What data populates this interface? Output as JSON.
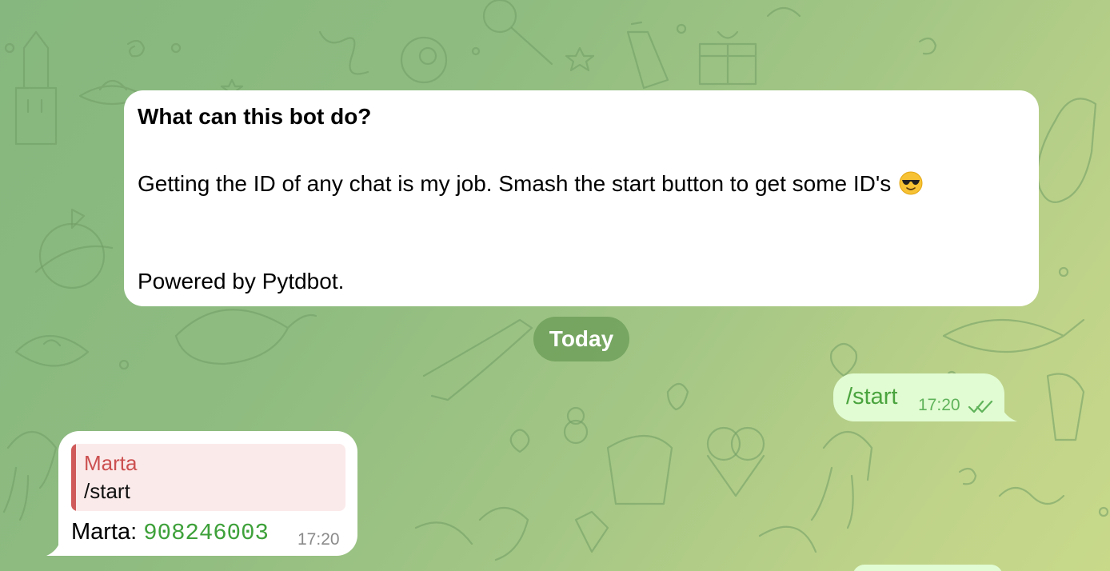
{
  "bot_info": {
    "title": "What can this bot do?",
    "description": "Getting the ID of any chat is my job. Smash the start button to get some ID's",
    "emoji_icon": "smiling-face-with-sunglasses-icon",
    "powered_by": "Powered by Pytdbot."
  },
  "date_separator": "Today",
  "outgoing_message": {
    "text": "/start",
    "time": "17:20",
    "status_icon": "double-check-icon"
  },
  "incoming_message": {
    "reply": {
      "name": "Marta",
      "text": "/start"
    },
    "sender": "Marta",
    "separator": ": ",
    "chat_id": "908246003",
    "time": "17:20"
  },
  "colors": {
    "outgoing_bubble": "#e1fbd2",
    "outgoing_text": "#4aa43e",
    "reply_accent": "#d05a5a",
    "id_text": "#3ea13a",
    "date_pill": "#6ea05a"
  }
}
